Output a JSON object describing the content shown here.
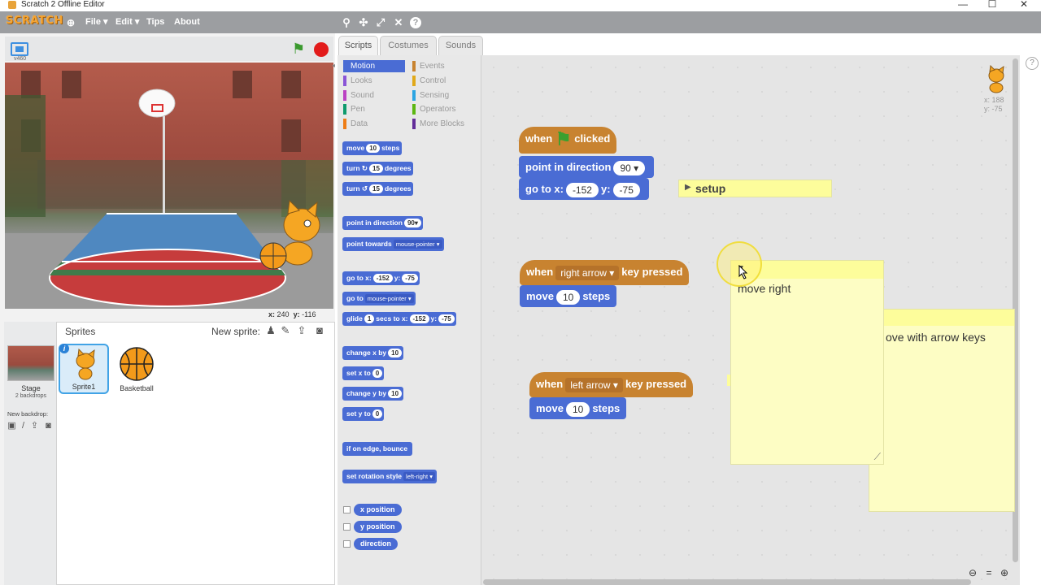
{
  "window": {
    "title": "Scratch 2 Offline Editor",
    "minimize": "—",
    "maximize": "☐",
    "close": "✕"
  },
  "menubar": {
    "logo": "SCRATCH",
    "items": [
      "File ▾",
      "Edit ▾",
      "Tips",
      "About"
    ]
  },
  "stage": {
    "version": "v460",
    "mouse_x_label": "x:",
    "mouse_x": "240",
    "mouse_y_label": "y:",
    "mouse_y": "-116"
  },
  "sprites": {
    "title": "Sprites",
    "new_sprite_label": "New sprite:",
    "stage_label": "Stage",
    "stage_backdrops": "2 backdrops",
    "new_backdrop_label": "New backdrop:",
    "items": [
      {
        "name": "Sprite1"
      },
      {
        "name": "Basketball"
      }
    ]
  },
  "tabs": [
    "Scripts",
    "Costumes",
    "Sounds"
  ],
  "categories": {
    "left": [
      {
        "label": "Motion",
        "color": "#4a6cd4"
      },
      {
        "label": "Looks",
        "color": "#8a55d7"
      },
      {
        "label": "Sound",
        "color": "#bb42c3"
      },
      {
        "label": "Pen",
        "color": "#0e9a6c"
      },
      {
        "label": "Data",
        "color": "#ee7d16"
      }
    ],
    "right": [
      {
        "label": "Events",
        "color": "#c88330"
      },
      {
        "label": "Control",
        "color": "#e1a91a"
      },
      {
        "label": "Sensing",
        "color": "#2ca5e2"
      },
      {
        "label": "Operators",
        "color": "#5cb712"
      },
      {
        "label": "More Blocks",
        "color": "#632d99"
      }
    ]
  },
  "palette": {
    "move": [
      "move",
      "10",
      "steps"
    ],
    "turn_cw": [
      "turn",
      "15",
      "degrees"
    ],
    "turn_ccw": [
      "turn",
      "15",
      "degrees"
    ],
    "point_dir": [
      "point in direction",
      "90"
    ],
    "point_towards": [
      "point towards",
      "mouse-pointer"
    ],
    "goto_xy": [
      "go to x:",
      "-152",
      "y:",
      "-75"
    ],
    "goto": [
      "go to",
      "mouse-pointer"
    ],
    "glide": [
      "glide",
      "1",
      "secs to x:",
      "-152",
      "y:",
      "-75"
    ],
    "change_x": [
      "change x by",
      "10"
    ],
    "set_x": [
      "set x to",
      "0"
    ],
    "change_y": [
      "change y by",
      "10"
    ],
    "set_y": [
      "set y to",
      "0"
    ],
    "bounce": "if on edge, bounce",
    "rotation": [
      "set rotation style",
      "left-right"
    ],
    "reporters": [
      "x position",
      "y position",
      "direction"
    ]
  },
  "scripts": {
    "flag_hat": [
      "when",
      "clicked"
    ],
    "point_dir": [
      "point in direction",
      "90"
    ],
    "goto_xy": [
      "go to x:",
      "-152",
      "y:",
      "-75"
    ],
    "setup_note": "setup",
    "right_hat": [
      "when",
      "right arrow",
      "key pressed"
    ],
    "right_move": [
      "move",
      "10",
      "steps"
    ],
    "right_note": "move right",
    "left_hat": [
      "when",
      "left arrow",
      "key pressed"
    ],
    "left_move": [
      "move",
      "10",
      "steps"
    ],
    "arrow_note": "ove with arrow keys"
  },
  "sprite_info": {
    "x_label": "x:",
    "x": "188",
    "y_label": "y:",
    "y": "-75"
  },
  "colors": {
    "motion": "#4a6cd4",
    "events": "#c88330",
    "menubar": "#9c9ea1",
    "note": "#fdfdc4"
  }
}
